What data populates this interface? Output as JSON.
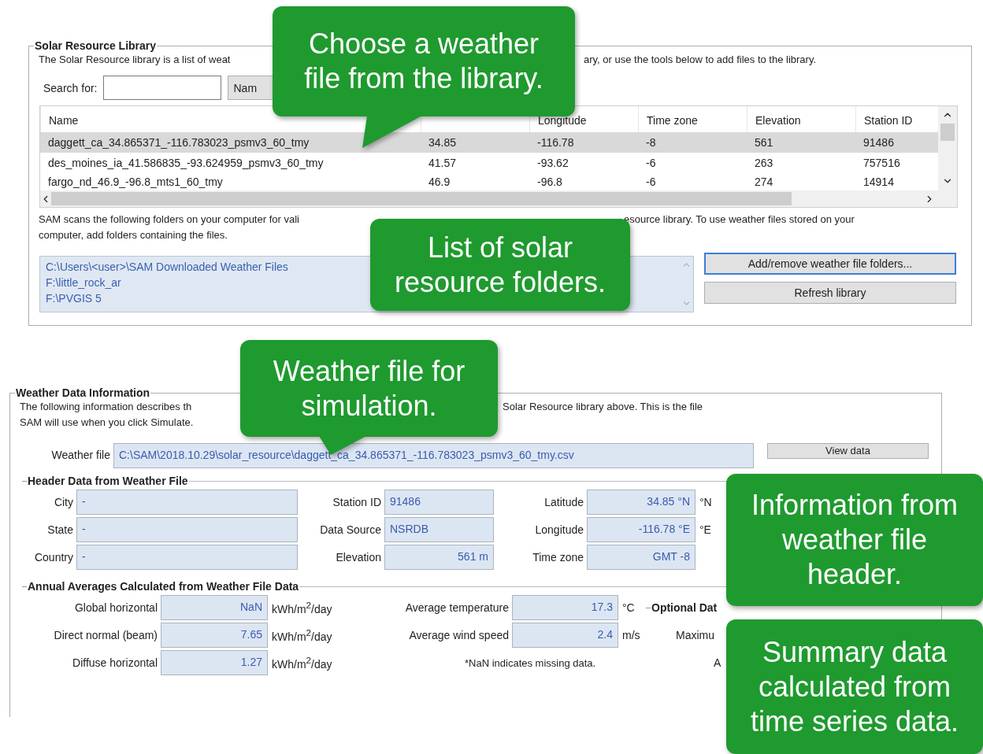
{
  "library": {
    "title": "Solar Resource Library",
    "description_parts": [
      "The Solar Resource library is a list of weat",
      "ary, or use the tools below to add files to the library."
    ],
    "search": {
      "label": "Search for:",
      "by_button": "Nam"
    },
    "table": {
      "columns": [
        "Name",
        "",
        "Longitude",
        "Time zone",
        "Elevation",
        "Station ID"
      ],
      "rows": [
        {
          "cells": [
            "daggett_ca_34.865371_-116.783023_psmv3_60_tmy",
            "34.85",
            "-116.78",
            "-8",
            "561",
            "91486"
          ],
          "selected": true
        },
        {
          "cells": [
            "des_moines_ia_41.586835_-93.624959_psmv3_60_tmy",
            "41.57",
            "-93.62",
            "-6",
            "263",
            "757516"
          ],
          "selected": false
        },
        {
          "cells": [
            "fargo_nd_46.9_-96.8_mts1_60_tmy",
            "46.9",
            "-96.8",
            "-6",
            "274",
            "14914"
          ],
          "selected": false
        }
      ]
    },
    "note_parts": [
      "SAM scans the following folders on your computer for vali",
      "esource library. To use weather files stored on your"
    ],
    "note_line2": "computer, add folders containing the files.",
    "folders": [
      "C:\\Users\\<user>\\SAM Downloaded Weather Files",
      "F:\\little_rock_ar",
      "F:\\PVGIS 5"
    ],
    "buttons": [
      {
        "label": "Add/remove weather file folders...",
        "focused": true
      },
      {
        "label": "Refresh library",
        "focused": false
      }
    ]
  },
  "weather": {
    "title": "Weather Data Information",
    "description_parts": [
      "The following information describes th",
      "Solar Resource library above. This is the file"
    ],
    "description_line2": "SAM will use when you click Simulate.",
    "file": {
      "label": "Weather file",
      "value": "C:\\SAM\\2018.10.29\\solar_resource\\daggett_ca_34.865371_-116.783023_psmv3_60_tmy.csv"
    },
    "view_button": "View data",
    "header": {
      "title": "Header Data from Weather File",
      "rows": [
        [
          {
            "label": "City",
            "value": "-",
            "kind": "text"
          },
          {
            "label": "Station ID",
            "value": "91486",
            "kind": "text"
          },
          {
            "label": "Latitude",
            "value": "34.85 °N",
            "kind": "number",
            "unit": "°N"
          }
        ],
        [
          {
            "label": "State",
            "value": "-",
            "kind": "text"
          },
          {
            "label": "Data Source",
            "value": "NSRDB",
            "kind": "text"
          },
          {
            "label": "Longitude",
            "value": "-116.78 °E",
            "kind": "number",
            "unit": "°E"
          }
        ],
        [
          {
            "label": "Country",
            "value": "-",
            "kind": "text"
          },
          {
            "label": "Elevation",
            "value": "561 m",
            "kind": "number"
          },
          {
            "label": "Time zone",
            "value": "GMT -8",
            "kind": "number"
          }
        ]
      ]
    },
    "annual": {
      "title": "Annual Averages Calculated from Weather File  Data",
      "rows": [
        {
          "left": {
            "label": "Global horizontal",
            "value": "NaN",
            "unit": "kWh/m$^{2}$/day"
          },
          "right": {
            "kind": "field",
            "label": "Average temperature",
            "value": "17.3",
            "unit": "°C"
          },
          "optional": {
            "text": "Optional Dat",
            "kind": "heading"
          }
        },
        {
          "left": {
            "label": "Direct normal (beam)",
            "value": "7.65",
            "unit": "kWh/m$^{2}$/day"
          },
          "right": {
            "kind": "field",
            "label": "Average wind speed",
            "value": "2.4",
            "unit": "m/s"
          },
          "optional": {
            "text": "Maximu",
            "kind": "label"
          }
        },
        {
          "left": {
            "label": "Diffuse horizontal",
            "value": "1.27",
            "unit": "kWh/m$^{2}$/day"
          },
          "right": {
            "kind": "note",
            "text": "*NaN indicates missing data."
          },
          "optional": {
            "text": "A",
            "kind": "label"
          }
        }
      ]
    }
  },
  "callouts": [
    {
      "text": "Choose a weather\nfile from the library.",
      "kind": "pointer"
    },
    {
      "text": "List of solar\nresource folders.",
      "kind": "plain"
    },
    {
      "text": "Weather file for\nsimulation.",
      "kind": "pointer"
    },
    {
      "text": "Information from\nweather file\nheader.",
      "kind": "plain"
    },
    {
      "text": "Summary data\ncalculated from\ntime series data.",
      "kind": "plain"
    }
  ]
}
